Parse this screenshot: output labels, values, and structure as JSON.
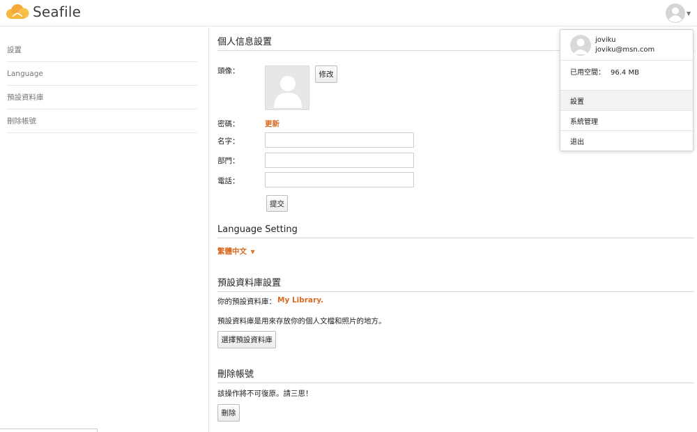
{
  "header": {
    "logo_text": "Seafile",
    "avatar_icon": "user-avatar-icon",
    "caret_icon": "caret-down-icon"
  },
  "sidebar": {
    "items": [
      {
        "label": "設置"
      },
      {
        "label": "Language"
      },
      {
        "label": "預設資料庫"
      },
      {
        "label": "刪除帳號"
      }
    ]
  },
  "profile": {
    "title": "個人信息設置",
    "avatar_label": "頭像：",
    "avatar_change_button": "修改",
    "password_label": "密碼：",
    "password_update_link": "更新",
    "name_label": "名字：",
    "name_value": "",
    "department_label": "部門：",
    "department_value": "",
    "phone_label": "電話：",
    "phone_value": "",
    "submit_button": "提交"
  },
  "language": {
    "title": "Language Setting",
    "current": "繁體中文"
  },
  "default_library": {
    "title": "預設資料庫設置",
    "label": "你的預設資料庫：",
    "value": "My Library.",
    "description": "預設資料庫是用來存放你的個人文檔和照片的地方。",
    "choose_button": "選擇預設資料庫"
  },
  "delete_account": {
    "title": "刪除帳號",
    "warning": "該操作將不可復原。請三思！",
    "delete_button": "刪除"
  },
  "user_menu": {
    "name": "joviku",
    "email": "joviku@msn.com",
    "space_label": "已用空間：",
    "space_value": "96.4 MB",
    "items": [
      {
        "label": "設置",
        "active": true
      },
      {
        "label": "系統管理",
        "active": false
      },
      {
        "label": "退出",
        "active": false
      }
    ]
  },
  "colors": {
    "accent": "#d9691f",
    "logo_cloud": "#f4b33d"
  }
}
